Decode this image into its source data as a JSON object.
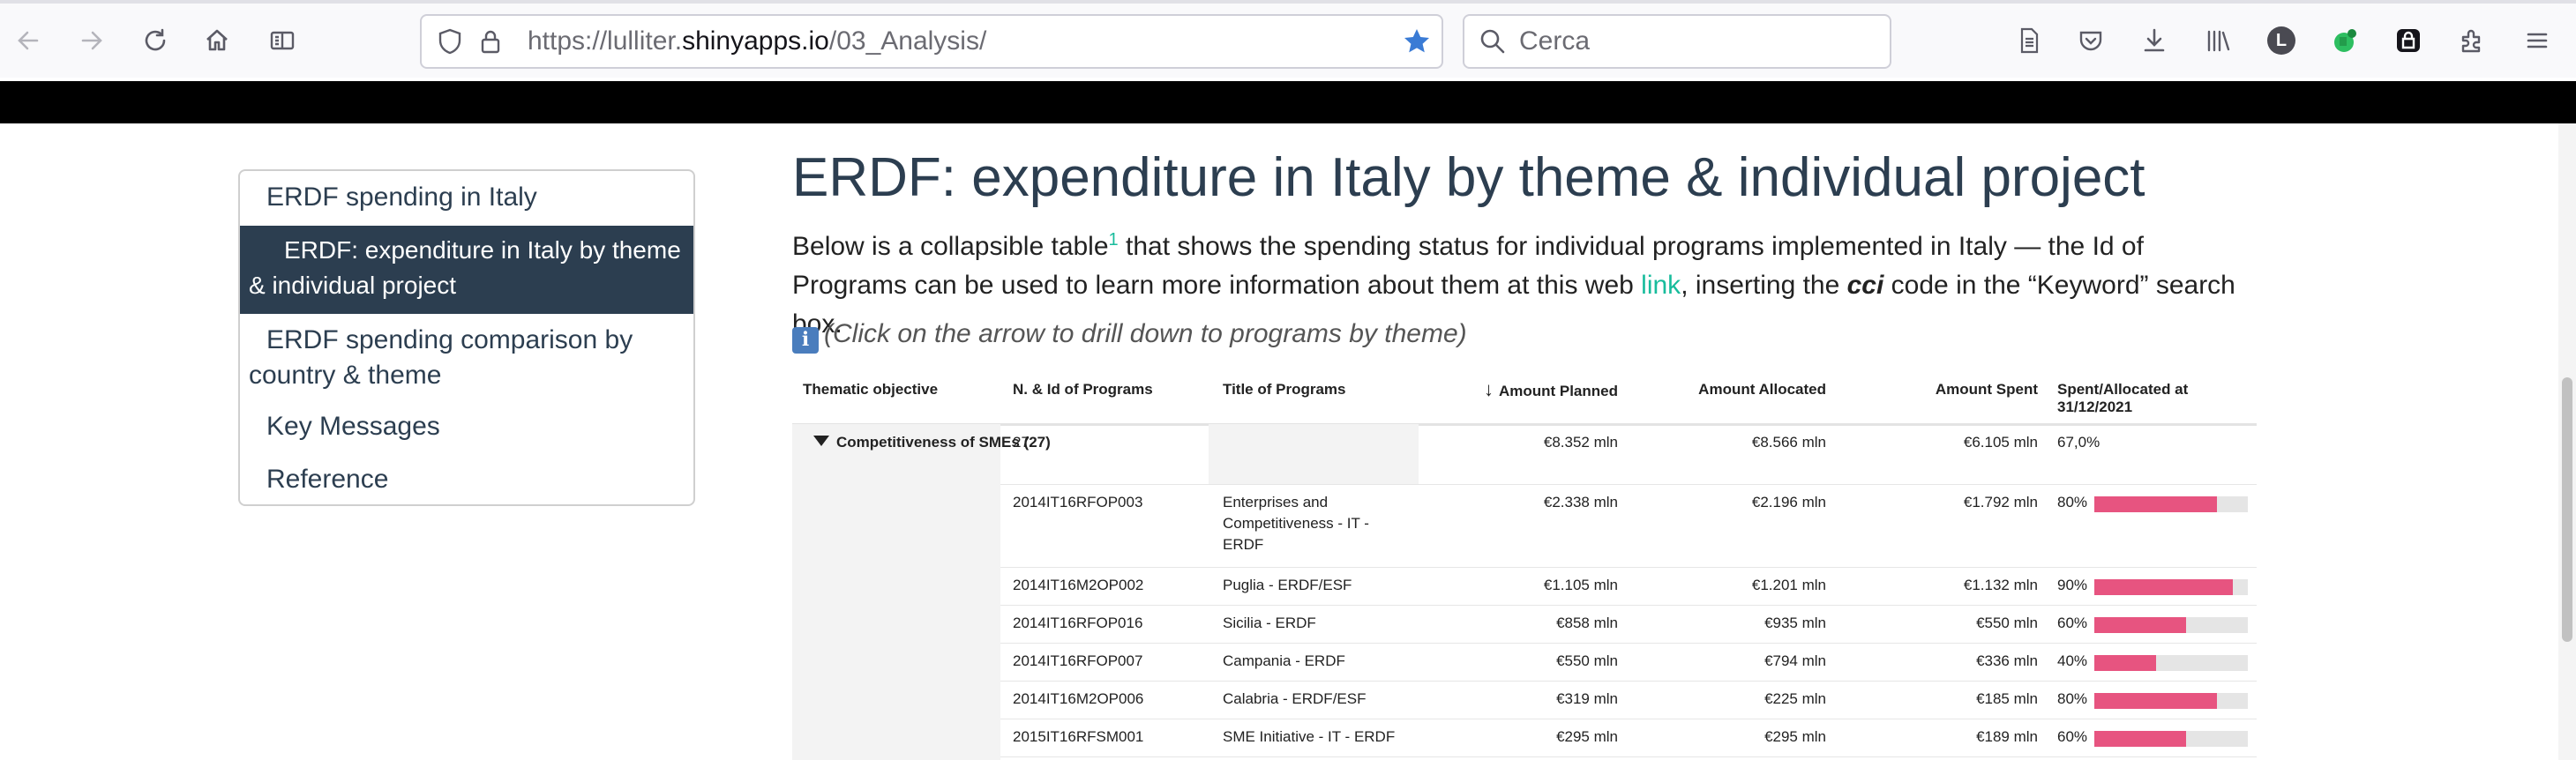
{
  "browser": {
    "url_prefix": "https://lulliter.",
    "url_host": "shinyapps.io",
    "url_path": "/03_Analysis/",
    "search_placeholder": "Cerca",
    "account_initial": "L"
  },
  "toc": {
    "items": [
      {
        "label": "ERDF spending in Italy",
        "active": false
      },
      {
        "label": "ERDF: expenditure in Italy by theme & individual project",
        "active": true
      },
      {
        "label": "ERDF spending comparison by country & theme",
        "active": false
      },
      {
        "label": "Key Messages",
        "active": false
      },
      {
        "label": "Reference",
        "active": false
      }
    ]
  },
  "main": {
    "title": "ERDF: expenditure in Italy by theme & individual project",
    "intro_a": "Below is a collapsible table",
    "intro_footnote": "1",
    "intro_b": " that shows the spending status for individual programs implemented in Italy — the Id of Programs can be used to learn more information about them at this web ",
    "intro_link": "link",
    "intro_c": ", inserting the ",
    "intro_code": "cci",
    "intro_d": " code in the “Keyword” search box.",
    "hint": "(Click on the arrow to drill down to programs by theme)",
    "hint_icon": "ℹ"
  },
  "table": {
    "headers": {
      "thematic": "Thematic objective",
      "programs": "N. & Id of Programs",
      "title": "Title of Programs",
      "sort_arrow": "↓",
      "planned": "Amount Planned",
      "allocated": "Amount Allocated",
      "spent": "Amount Spent",
      "ratio": "Spent/Allocated at 31/12/2021"
    },
    "group": {
      "label": "Competitiveness of SMEs (27)",
      "count": "27",
      "planned": "€8.352 mln",
      "allocated": "€8.566 mln",
      "spent": "€6.105 mln",
      "ratio": "67,0%"
    },
    "rows": [
      {
        "id": "2014IT16RFOP003",
        "title": "Enterprises and Competitiveness - IT - ERDF",
        "planned": "€2.338 mln",
        "allocated": "€2.196 mln",
        "spent": "€1.792 mln",
        "pct_label": "80%",
        "pct": 0.8
      },
      {
        "id": "2014IT16M2OP002",
        "title": "Puglia - ERDF/ESF",
        "planned": "€1.105 mln",
        "allocated": "€1.201 mln",
        "spent": "€1.132 mln",
        "pct_label": "90%",
        "pct": 0.9
      },
      {
        "id": "2014IT16RFOP016",
        "title": "Sicilia - ERDF",
        "planned": "€858 mln",
        "allocated": "€935 mln",
        "spent": "€550 mln",
        "pct_label": "60%",
        "pct": 0.6
      },
      {
        "id": "2014IT16RFOP007",
        "title": "Campania - ERDF",
        "planned": "€550 mln",
        "allocated": "€794 mln",
        "spent": "€336 mln",
        "pct_label": "40%",
        "pct": 0.4
      },
      {
        "id": "2014IT16M2OP006",
        "title": "Calabria - ERDF/ESF",
        "planned": "€319 mln",
        "allocated": "€225 mln",
        "spent": "€185 mln",
        "pct_label": "80%",
        "pct": 0.8
      },
      {
        "id": "2015IT16RFSM001",
        "title": "SME Initiative - IT - ERDF",
        "planned": "€295 mln",
        "allocated": "€295 mln",
        "spent": "€189 mln",
        "pct_label": "60%",
        "pct": 0.6
      }
    ]
  },
  "colors": {
    "accent_link": "#18bc9c",
    "active_toc": "#2c3e50",
    "bar_fill": "#e75480",
    "bookmark_star": "#3a7bd5"
  }
}
